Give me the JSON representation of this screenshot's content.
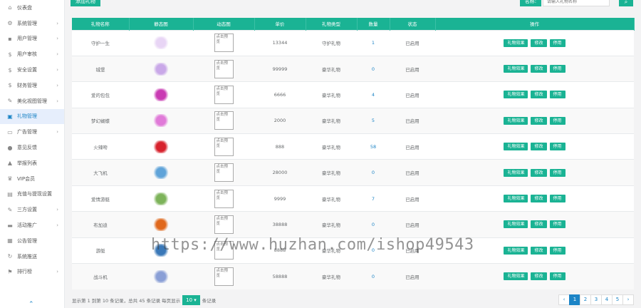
{
  "sidebar": {
    "items": [
      {
        "icon": "home-icon",
        "glyph": "⌂",
        "label": "仪表盘",
        "chev": ""
      },
      {
        "icon": "gear-icon",
        "glyph": "⚙",
        "label": "系统管理",
        "chev": "›"
      },
      {
        "icon": "user-icon",
        "glyph": "▪",
        "label": "用户管理",
        "chev": "›"
      },
      {
        "icon": "dollar-icon",
        "glyph": "$",
        "label": "用户审核",
        "chev": "›"
      },
      {
        "icon": "dollar-icon",
        "glyph": "$",
        "label": "安全设置",
        "chev": "›"
      },
      {
        "icon": "dollar-icon",
        "glyph": "$",
        "label": "财务管理",
        "chev": "›"
      },
      {
        "icon": "wrench-icon",
        "glyph": "✎",
        "label": "美化视图管理",
        "chev": "›"
      },
      {
        "icon": "gift-icon",
        "glyph": "▣",
        "label": "礼物管理",
        "chev": ""
      },
      {
        "icon": "ad-icon",
        "glyph": "▭",
        "label": "广告管理",
        "chev": "›"
      },
      {
        "icon": "feedback-icon",
        "glyph": "●",
        "label": "意见反馈",
        "chev": ""
      },
      {
        "icon": "warning-icon",
        "glyph": "▲",
        "label": "举报列表",
        "chev": ""
      },
      {
        "icon": "vip-icon",
        "glyph": "♛",
        "label": "VIP会员",
        "chev": ""
      },
      {
        "icon": "withdraw-icon",
        "glyph": "▤",
        "label": "充值与提现设置",
        "chev": ""
      },
      {
        "icon": "tools-icon",
        "glyph": "✎",
        "label": "三方设置",
        "chev": "›"
      },
      {
        "icon": "promo-icon",
        "glyph": "▬",
        "label": "活动推广",
        "chev": "›"
      },
      {
        "icon": "grid-icon",
        "glyph": "▦",
        "label": "公告管理",
        "chev": ""
      },
      {
        "icon": "refresh-icon",
        "glyph": "↻",
        "label": "系统推送",
        "chev": ""
      },
      {
        "icon": "flag-icon",
        "glyph": "⚑",
        "label": "排行榜",
        "chev": "›"
      }
    ],
    "active_index": 7
  },
  "toolbar": {
    "add_label": "添加礼物",
    "search_label": "名称:",
    "search_placeholder": "请输入礼物名称",
    "search_icon": "search-icon"
  },
  "table": {
    "headers": [
      "礼物名称",
      "静态图",
      "动态图",
      "单价",
      "礼物类型",
      "数量",
      "状态",
      "操作"
    ],
    "dyn_text": "点击预览",
    "ops": [
      "礼物效果",
      "修改",
      "停用"
    ],
    "rows": [
      {
        "name": "守护一生",
        "price": "13344",
        "type": "守护礼物",
        "qty": "1",
        "status": "已启用",
        "color": "#e8d5f5"
      },
      {
        "name": "城堡",
        "price": "99999",
        "type": "豪华礼物",
        "qty": "0",
        "status": "已启用",
        "color": "#c9a8e8"
      },
      {
        "name": "爱的包包",
        "price": "6666",
        "type": "豪华礼物",
        "qty": "4",
        "status": "已启用",
        "color": "#c93bb3"
      },
      {
        "name": "梦幻蝴蝶",
        "price": "2000",
        "type": "豪华礼物",
        "qty": "5",
        "status": "已启用",
        "color": "#e07ad8"
      },
      {
        "name": "火辣吻",
        "price": "888",
        "type": "豪华礼物",
        "qty": "58",
        "status": "已启用",
        "color": "#d7222d"
      },
      {
        "name": "大飞机",
        "price": "28000",
        "type": "豪华礼物",
        "qty": "0",
        "status": "已启用",
        "color": "#5fa3d9"
      },
      {
        "name": "爱情游艇",
        "price": "9999",
        "type": "豪华礼物",
        "qty": "7",
        "status": "已启用",
        "color": "#7db35a"
      },
      {
        "name": "布加迪",
        "price": "38888",
        "type": "豪华礼物",
        "qty": "0",
        "status": "已启用",
        "color": "#e0681c"
      },
      {
        "name": "游艇",
        "price": "8888",
        "type": "豪华礼物",
        "qty": "0",
        "status": "已启用",
        "color": "#3a78b8"
      },
      {
        "name": "战斗机",
        "price": "58888",
        "type": "豪华礼物",
        "qty": "0",
        "status": "已启用",
        "color": "#8a9fd6"
      }
    ]
  },
  "footer": {
    "summary": "显示第 1 到第 10 条记录，总共 45 条记录 每页显示",
    "page_size": "10 ▾",
    "suffix": "条记录",
    "pages": [
      "‹",
      "1",
      "2",
      "3",
      "4",
      "5",
      "›"
    ],
    "active_page": "1"
  },
  "watermark": "https://www.huzhan.com/ishop49543"
}
